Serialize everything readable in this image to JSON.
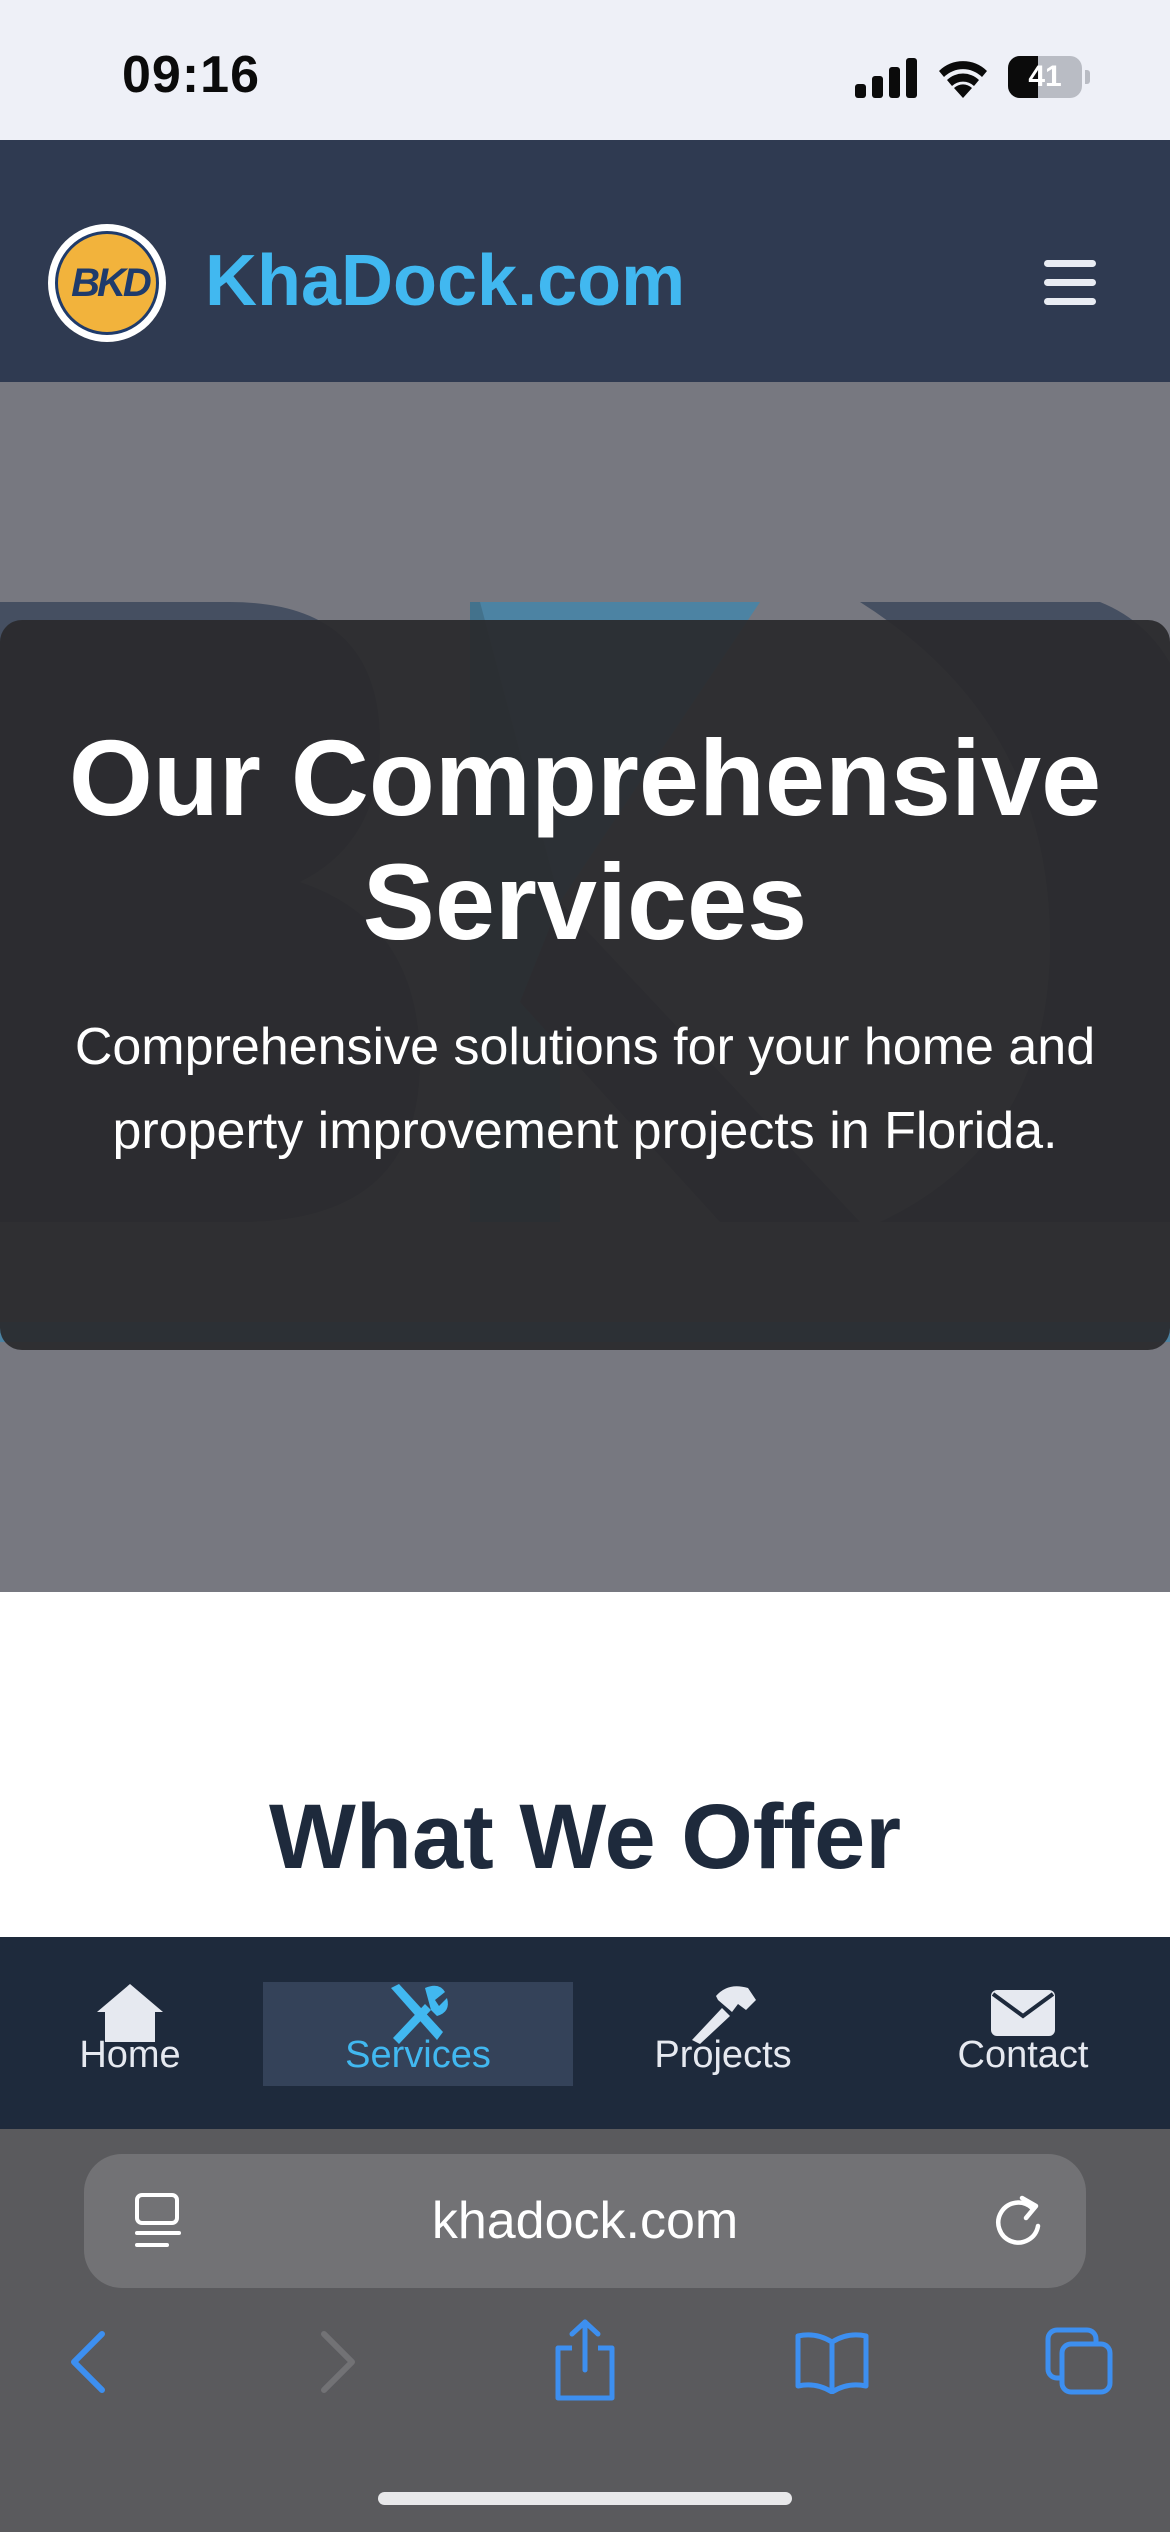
{
  "status_bar": {
    "time": "09:16",
    "battery_level": "41",
    "battery_fraction": 0.41,
    "icons": [
      "signal-icon",
      "wifi-icon",
      "battery-icon"
    ]
  },
  "header": {
    "logo_text": "BKD",
    "site_title": "KhaDock.com",
    "menu_icon": "hamburger-menu-icon"
  },
  "hero": {
    "title": "Our Comprehensive Services",
    "subtitle": "Comprehensive solutions for your home and property improvement projects in Florida."
  },
  "section": {
    "heading": "What We Offer"
  },
  "bottom_nav": {
    "items": [
      {
        "label": "Home",
        "icon": "house-icon",
        "active": false
      },
      {
        "label": "Services",
        "icon": "tools-icon",
        "active": true
      },
      {
        "label": "Projects",
        "icon": "hammer-icon",
        "active": false
      },
      {
        "label": "Contact",
        "icon": "envelope-icon",
        "active": false
      }
    ]
  },
  "browser": {
    "url": "khadock.com",
    "toolbar_icons": [
      "back-icon",
      "forward-icon",
      "share-icon",
      "bookmarks-icon",
      "tabs-icon"
    ]
  },
  "colors": {
    "accent": "#41b8f0",
    "header_bg": "#2f3a51",
    "nav_bg": "#1e2a3c",
    "browser_link": "#3d8ff0"
  }
}
